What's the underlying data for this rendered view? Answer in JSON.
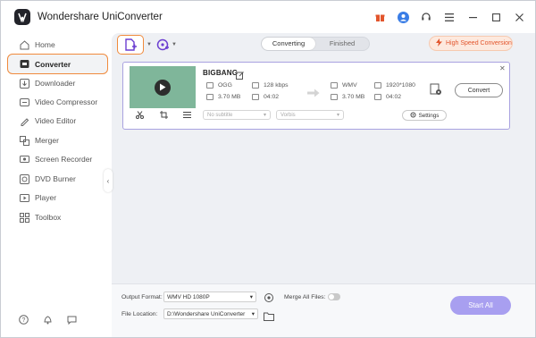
{
  "app": {
    "title": "Wondershare UniConverter"
  },
  "title_controls": [
    "gift-icon",
    "user-icon",
    "headset-icon",
    "menu-icon",
    "minimize-icon",
    "maximize-icon",
    "close-icon"
  ],
  "sidebar": {
    "items": [
      {
        "label": "Home",
        "icon": "home-icon",
        "active": false
      },
      {
        "label": "Converter",
        "icon": "converter-icon",
        "active": true
      },
      {
        "label": "Downloader",
        "icon": "downloader-icon",
        "active": false
      },
      {
        "label": "Video Compressor",
        "icon": "compressor-icon",
        "active": false
      },
      {
        "label": "Video Editor",
        "icon": "editor-icon",
        "active": false
      },
      {
        "label": "Merger",
        "icon": "merger-icon",
        "active": false
      },
      {
        "label": "Screen Recorder",
        "icon": "recorder-icon",
        "active": false
      },
      {
        "label": "DVD Burner",
        "icon": "dvd-icon",
        "active": false
      },
      {
        "label": "Player",
        "icon": "player-icon",
        "active": false
      },
      {
        "label": "Toolbox",
        "icon": "toolbox-icon",
        "active": false
      }
    ],
    "bottom_icons": [
      "help-icon",
      "notification-icon",
      "feedback-icon"
    ]
  },
  "toolbar": {
    "tabs": [
      "Converting",
      "Finished"
    ],
    "active_tab": "Converting",
    "high_speed": "High Speed Conversion"
  },
  "file": {
    "name": "BIGBANG",
    "source": {
      "format": "OGG",
      "size": "3.70 MB",
      "bitrate": "128 kbps",
      "duration": "04:02"
    },
    "target": {
      "format": "WMV",
      "size": "3.70 MB",
      "resolution": "1920*1080",
      "duration": "04:02"
    },
    "subtitle": "No subtitle",
    "audio": "Vorbis",
    "settings_label": "Settings",
    "convert_label": "Convert"
  },
  "bottom": {
    "output_format_label": "Output Format:",
    "output_format_value": "WMV HD 1080P",
    "merge_label": "Merge All Files:",
    "file_location_label": "File Location:",
    "file_location_value": "D:\\Wondershare UniConverter",
    "start_all": "Start All"
  },
  "colors": {
    "accent_orange": "#f08a3c",
    "accent_purple": "#a89ff0",
    "card_border": "#a9a2e0",
    "high_speed_text": "#e2552c"
  }
}
